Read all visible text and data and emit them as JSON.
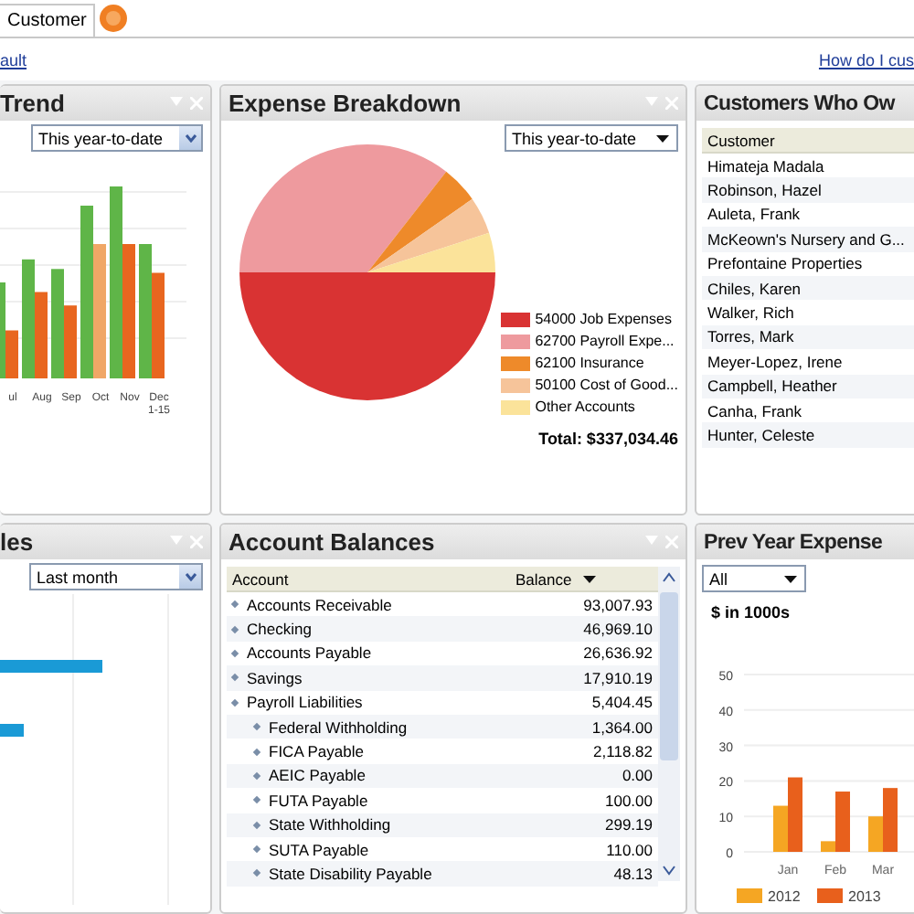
{
  "tab": {
    "label": "Customer"
  },
  "links": {
    "left": "ault",
    "right": "How do I cus"
  },
  "trend": {
    "title": "Trend",
    "period": "This year-to-date",
    "months": [
      "ul",
      "Aug",
      "Sep",
      "Oct",
      "Nov",
      "Dec 1-15"
    ]
  },
  "expense": {
    "title": "Expense Breakdown",
    "period": "This year-to-date",
    "legend": [
      {
        "label": "54000 Job Expenses",
        "color": "#d93333"
      },
      {
        "label": "62700  Payroll Expe...",
        "color": "#ee9a9e"
      },
      {
        "label": "62100 Insurance",
        "color": "#ee8a2a"
      },
      {
        "label": "50100 Cost of Good...",
        "color": "#f6c49a"
      },
      {
        "label": "Other Accounts",
        "color": "#fbe39a"
      }
    ],
    "total": "Total: $337,034.46"
  },
  "customers": {
    "title": "Customers Who Ow",
    "column": "Customer",
    "rows": [
      "Himateja Madala",
      "Robinson, Hazel",
      "Auleta, Frank",
      "McKeown's Nursery and G...",
      "Prefontaine Properties",
      "Chiles, Karen",
      "Walker, Rich",
      "Torres, Mark",
      "Meyer-Lopez, Irene",
      "Campbell, Heather",
      "Canha, Frank",
      "Hunter, Celeste"
    ]
  },
  "sales": {
    "title": "les",
    "period": "Last month"
  },
  "balances": {
    "title": "Account Balances",
    "columns": [
      "Account",
      "Balance"
    ],
    "rows": [
      {
        "account": "Accounts Receivable",
        "balance": "93,007.93"
      },
      {
        "account": "Checking",
        "balance": "46,969.10"
      },
      {
        "account": "Accounts Payable",
        "balance": "26,636.92"
      },
      {
        "account": "Savings",
        "balance": "17,910.19"
      },
      {
        "account": "Payroll Liabilities",
        "balance": "5,404.45",
        "children": [
          {
            "account": "Federal Withholding",
            "balance": "1,364.00"
          },
          {
            "account": "FICA Payable",
            "balance": "2,118.82"
          },
          {
            "account": "AEIC Payable",
            "balance": "0.00"
          },
          {
            "account": "FUTA Payable",
            "balance": "100.00"
          },
          {
            "account": "State Withholding",
            "balance": "299.19"
          },
          {
            "account": "SUTA Payable",
            "balance": "110.00"
          },
          {
            "account": "State Disability Payable",
            "balance": "48.13"
          }
        ]
      }
    ]
  },
  "prev": {
    "title": "Prev Year Expense",
    "filter": "All",
    "unit": "$ in 1000s",
    "chart_data": {
      "type": "bar",
      "categories": [
        "Jan",
        "Feb",
        "Mar"
      ],
      "series": [
        {
          "name": "2012",
          "color": "#f5a623",
          "values": [
            13,
            3,
            10
          ]
        },
        {
          "name": "2013",
          "color": "#e8601c",
          "values": [
            21,
            17,
            18
          ]
        }
      ],
      "ylim": [
        0,
        50
      ],
      "yticks": [
        0,
        10,
        20,
        30,
        40,
        50
      ],
      "grid": true,
      "legend": "bottom"
    }
  }
}
